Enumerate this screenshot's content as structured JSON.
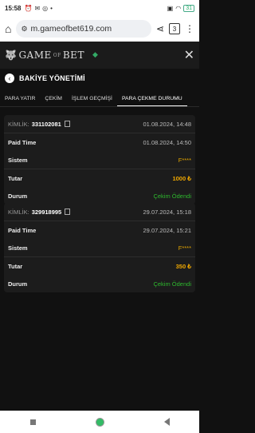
{
  "status": {
    "time": "15:58",
    "battery": "31"
  },
  "browser": {
    "url": "m.gameofbet619.com",
    "tab_count": "3"
  },
  "site": {
    "logo": "GAME",
    "logo_small": "OF",
    "logo2": "BET"
  },
  "page": {
    "title": "BAKİYE YÖNETİMİ"
  },
  "tabs": [
    "PARA YATIR",
    "ÇEKİM",
    "İŞLEM GEÇMİŞİ",
    "PARA ÇEKME DURUMU"
  ],
  "transactions": [
    {
      "id_label": "KİMLİK:",
      "id": "331102081",
      "date": "01.08.2024, 14:48",
      "paid_label": "Paid Time",
      "paid_time": "01.08.2024, 14:50",
      "system_label": "Sistem",
      "system": "F****",
      "amount_label": "Tutar",
      "amount": "1000 ₺",
      "status_label": "Durum",
      "status": "Çekim Ödendi"
    },
    {
      "id_label": "KİMLİK:",
      "id": "329918995",
      "date": "29.07.2024, 15:18",
      "paid_label": "Paid Time",
      "paid_time": "29.07.2024, 15:21",
      "system_label": "Sistem",
      "system": "F****",
      "amount_label": "Tutar",
      "amount": "350 ₺",
      "status_label": "Durum",
      "status": "Çekim Ödendi"
    }
  ]
}
